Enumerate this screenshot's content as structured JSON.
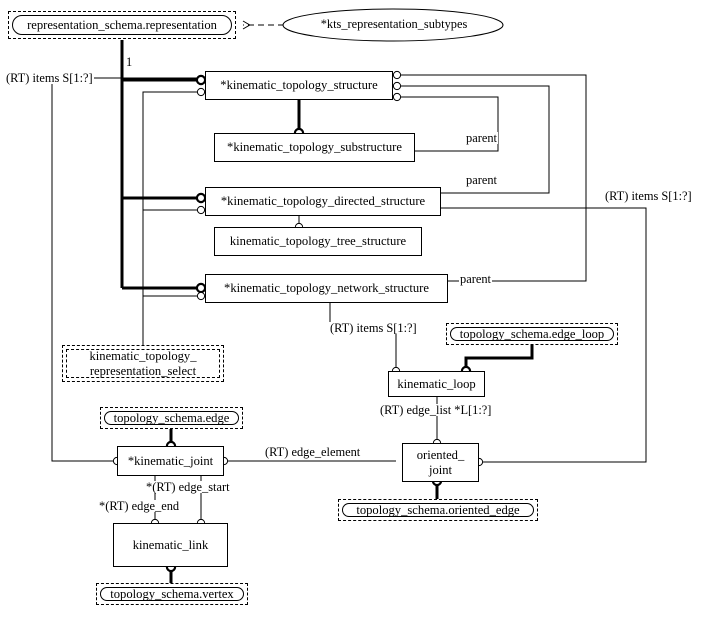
{
  "diagram": {
    "title": "kinematic topology schema EXPRESS-G diagram",
    "style": "express-g",
    "colors": {
      "line": "#000000",
      "background": "#ffffff",
      "text": "#000000"
    }
  },
  "nodes": {
    "representation": {
      "label": "representation_schema.representation",
      "kind": "schema-ref"
    },
    "kts_subtypes": {
      "label": "*kts_representation_subtypes",
      "kind": "subtype-ellipse"
    },
    "kts": {
      "label": "*kinematic_topology_structure",
      "kind": "entity"
    },
    "ktss": {
      "label": "*kinematic_topology_substructure",
      "kind": "entity"
    },
    "ktds": {
      "label": "*kinematic_topology_directed_structure",
      "kind": "entity"
    },
    "ktts": {
      "label": "kinematic_topology_tree_structure",
      "kind": "entity"
    },
    "ktns": {
      "label": "*kinematic_topology_network_structure",
      "kind": "entity"
    },
    "ktrs": {
      "label": "kinematic_topology_\nrepresentation_select",
      "kind": "select"
    },
    "edge_loop": {
      "label": "topology_schema.edge_loop",
      "kind": "schema-ref"
    },
    "kinematic_loop": {
      "label": "kinematic_loop",
      "kind": "entity"
    },
    "edge": {
      "label": "topology_schema.edge",
      "kind": "schema-ref"
    },
    "kinematic_joint": {
      "label": "*kinematic_joint",
      "kind": "entity"
    },
    "oriented_joint": {
      "label": "oriented_\njoint",
      "kind": "entity"
    },
    "oriented_edge": {
      "label": "topology_schema.oriented_edge",
      "kind": "schema-ref"
    },
    "kinematic_link": {
      "label": "kinematic_link",
      "kind": "entity"
    },
    "vertex": {
      "label": "topology_schema.vertex",
      "kind": "schema-ref"
    }
  },
  "labels": {
    "cardinality_one": "1",
    "items_left": "(RT) items S[1:?]",
    "parent_sub": "parent",
    "parent_dir": "parent",
    "parent_net": "parent",
    "items_right": "(RT) items S[1:?]",
    "items_network": "(RT) items S[1:?]",
    "edge_list": "(RT) edge_list *L[1:?]",
    "edge_element": "(RT) edge_element",
    "edge_start": "*(RT) edge_start",
    "edge_end": "*(RT) edge_end"
  }
}
